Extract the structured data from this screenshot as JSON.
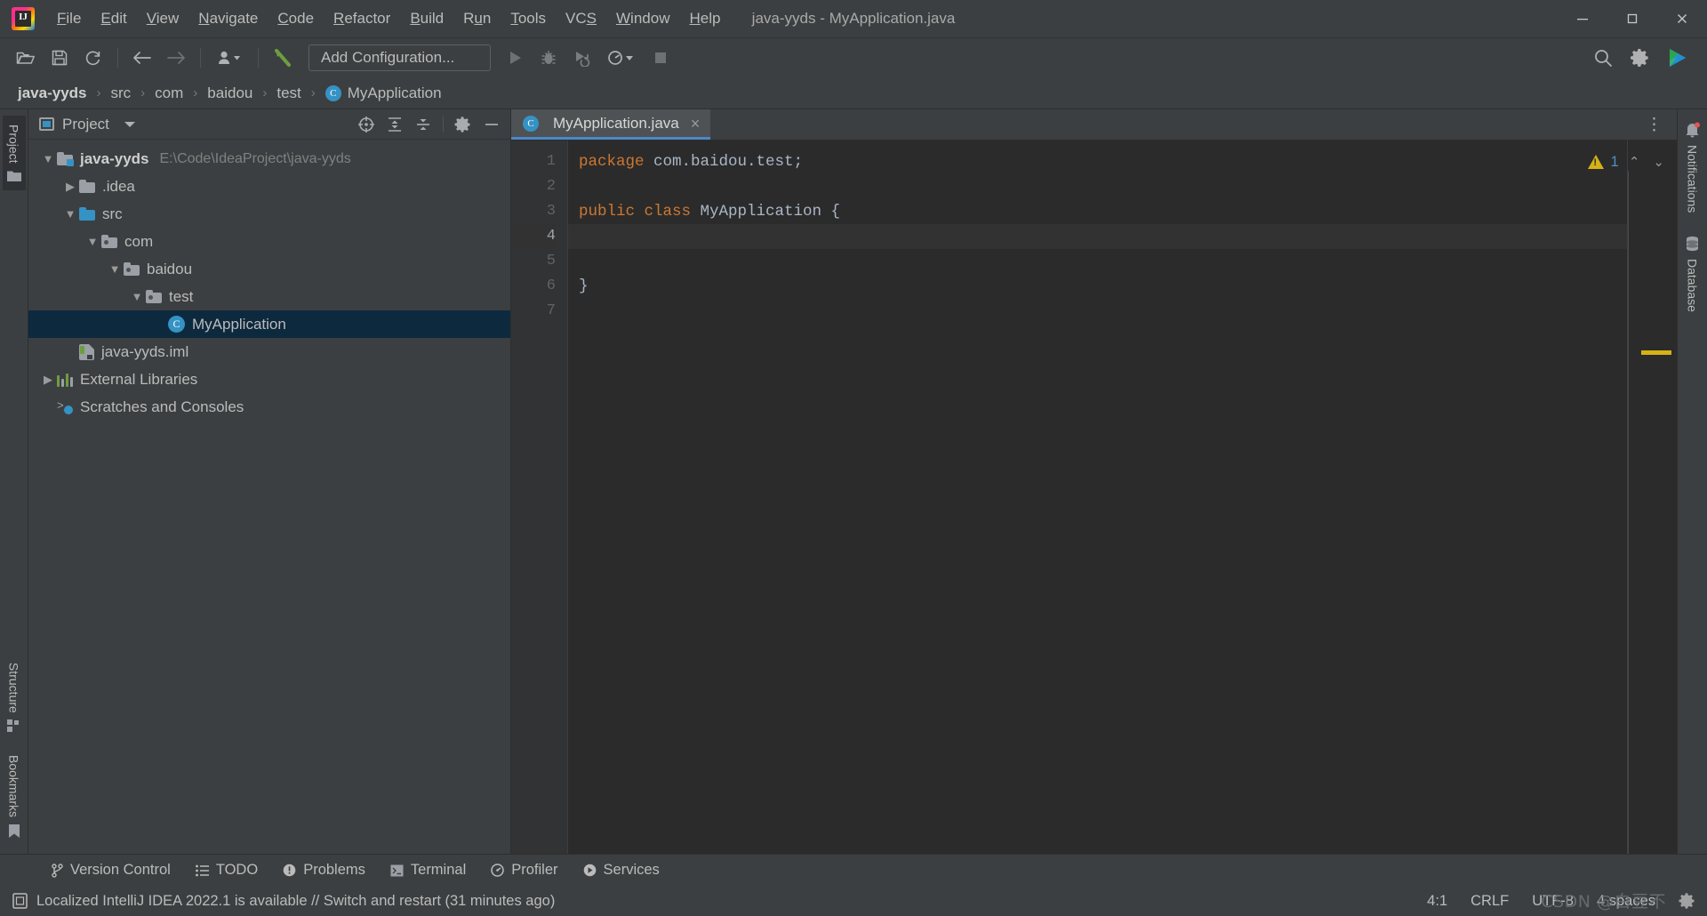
{
  "window": {
    "title": "java-yyds - MyApplication.java",
    "minimize_label": "minimize-icon",
    "maximize_label": "maximize-icon",
    "close_label": "close-icon"
  },
  "menu": {
    "items": [
      {
        "label": "File",
        "mnemonic": "F"
      },
      {
        "label": "Edit",
        "mnemonic": "E"
      },
      {
        "label": "View",
        "mnemonic": "V"
      },
      {
        "label": "Navigate",
        "mnemonic": "N"
      },
      {
        "label": "Code",
        "mnemonic": "C"
      },
      {
        "label": "Refactor",
        "mnemonic": "R"
      },
      {
        "label": "Build",
        "mnemonic": "B"
      },
      {
        "label": "Run",
        "mnemonic": "u"
      },
      {
        "label": "Tools",
        "mnemonic": "T"
      },
      {
        "label": "VCS",
        "mnemonic": "S"
      },
      {
        "label": "Window",
        "mnemonic": "W"
      },
      {
        "label": "Help",
        "mnemonic": "H"
      }
    ]
  },
  "toolbar": {
    "open_label": "open-folder-icon",
    "save_label": "save-all-icon",
    "sync_label": "reload-from-disk-icon",
    "back_label": "navigate-back-icon",
    "forward_label": "navigate-forward-icon",
    "profile_label": "user-dropdown-icon",
    "build_label": "build-hammer-icon",
    "run_configuration": "Add Configuration...",
    "run_label": "run-icon",
    "debug_label": "debug-icon",
    "coverage_label": "run-with-coverage-icon",
    "profiler_label": "profiler-icon",
    "stop_label": "stop-icon",
    "search_label": "search-everywhere-icon",
    "settings_label": "settings-gear-icon",
    "ide_label": "ide-logo-icon"
  },
  "breadcrumb": {
    "items": [
      "java-yyds",
      "src",
      "com",
      "baidou",
      "test",
      "MyApplication"
    ],
    "separator": "›",
    "class_badge": "C"
  },
  "left_rail": {
    "top": [
      {
        "label": "Project",
        "icon": "folder-icon"
      }
    ],
    "bottom": [
      {
        "label": "Structure",
        "icon": "structure-icon"
      },
      {
        "label": "Bookmarks",
        "icon": "bookmark-icon"
      }
    ]
  },
  "right_rail": {
    "items": [
      {
        "label": "Notifications",
        "icon": "bell-icon"
      },
      {
        "label": "Database",
        "icon": "database-icon"
      }
    ]
  },
  "project_panel": {
    "title": "Project",
    "actions": [
      {
        "name": "select-opened-file-icon"
      },
      {
        "name": "expand-all-icon"
      },
      {
        "name": "collapse-all-icon"
      },
      {
        "name": "settings-gear-icon"
      },
      {
        "name": "hide-panel-icon"
      }
    ],
    "tree": [
      {
        "label": "java-yyds",
        "sub": "E:\\Code\\IdeaProject\\java-yyds",
        "depth": 0,
        "arrow": "down",
        "icon": "module-folder-icon",
        "bold": true,
        "selected": false
      },
      {
        "label": ".idea",
        "sub": "",
        "depth": 1,
        "arrow": "right",
        "icon": "folder-icon",
        "bold": false,
        "selected": false
      },
      {
        "label": "src",
        "sub": "",
        "depth": 1,
        "arrow": "down",
        "icon": "source-folder-icon",
        "bold": false,
        "selected": false
      },
      {
        "label": "com",
        "sub": "",
        "depth": 2,
        "arrow": "down",
        "icon": "package-icon",
        "bold": false,
        "selected": false
      },
      {
        "label": "baidou",
        "sub": "",
        "depth": 3,
        "arrow": "down",
        "icon": "package-icon",
        "bold": false,
        "selected": false
      },
      {
        "label": "test",
        "sub": "",
        "depth": 4,
        "arrow": "down",
        "icon": "package-icon",
        "bold": false,
        "selected": false
      },
      {
        "label": "MyApplication",
        "sub": "",
        "depth": 5,
        "arrow": "none",
        "icon": "java-class-icon",
        "bold": false,
        "selected": true
      },
      {
        "label": "java-yyds.iml",
        "sub": "",
        "depth": 2,
        "arrow": "none",
        "icon": "iml-file-icon",
        "bold": false,
        "selected": false
      },
      {
        "label": "External Libraries",
        "sub": "",
        "depth": 0,
        "arrow": "right",
        "icon": "library-icon",
        "bold": false,
        "selected": false
      },
      {
        "label": "Scratches and Consoles",
        "sub": "",
        "depth": 0,
        "arrow": "none",
        "icon": "scratches-icon",
        "bold": false,
        "selected": false
      }
    ]
  },
  "editor": {
    "tabs": [
      {
        "label": "MyApplication.java",
        "icon": "java-class-icon",
        "active": true,
        "close": "×"
      }
    ],
    "options_icon": "more-options-icon",
    "line_numbers": [
      "1",
      "2",
      "3",
      "4",
      "5",
      "6",
      "7"
    ],
    "current_line": 4,
    "lines": [
      {
        "n": 1,
        "tokens": [
          {
            "t": "package",
            "c": "kw"
          },
          {
            "t": " com.baidou.test;",
            "c": "plain"
          }
        ]
      },
      {
        "n": 2,
        "tokens": []
      },
      {
        "n": 3,
        "tokens": [
          {
            "t": "public class",
            "c": "kw"
          },
          {
            "t": " MyApplication {",
            "c": "plain"
          }
        ]
      },
      {
        "n": 4,
        "tokens": []
      },
      {
        "n": 5,
        "tokens": []
      },
      {
        "n": 6,
        "tokens": [
          {
            "t": "}",
            "c": "plain"
          }
        ]
      },
      {
        "n": 7,
        "tokens": []
      }
    ],
    "inspection": {
      "warning_count": "1",
      "warning_icon": "warning-triangle-icon",
      "prev_icon": "previous-problem-icon",
      "next_icon": "next-problem-icon"
    }
  },
  "tool_windows": [
    {
      "label": "Version Control",
      "icon": "branch-icon"
    },
    {
      "label": "TODO",
      "icon": "todo-list-icon"
    },
    {
      "label": "Problems",
      "icon": "problems-icon"
    },
    {
      "label": "Terminal",
      "icon": "terminal-icon"
    },
    {
      "label": "Profiler",
      "icon": "profiler-icon"
    },
    {
      "label": "Services",
      "icon": "services-icon"
    }
  ],
  "status_bar": {
    "message_icon": "ide-update-icon",
    "message": "Localized IntelliJ IDEA 2022.1 is available // Switch and restart (31 minutes ago)",
    "caret_position": "4:1",
    "line_separator": "CRLF",
    "encoding": "UTF-8",
    "indent": "4 spaces",
    "watermark": "CSDN @白豆不",
    "settings_icon": "settings-gear-icon"
  },
  "colors": {
    "chrome": "#3c3f41",
    "editor_bg": "#2b2b2b",
    "gutter_bg": "#313335",
    "accent_blue": "#3592c4",
    "tab_underline": "#4a88c7",
    "selection": "#0d293e",
    "keyword": "#cc7832",
    "warning": "#d5b217"
  }
}
